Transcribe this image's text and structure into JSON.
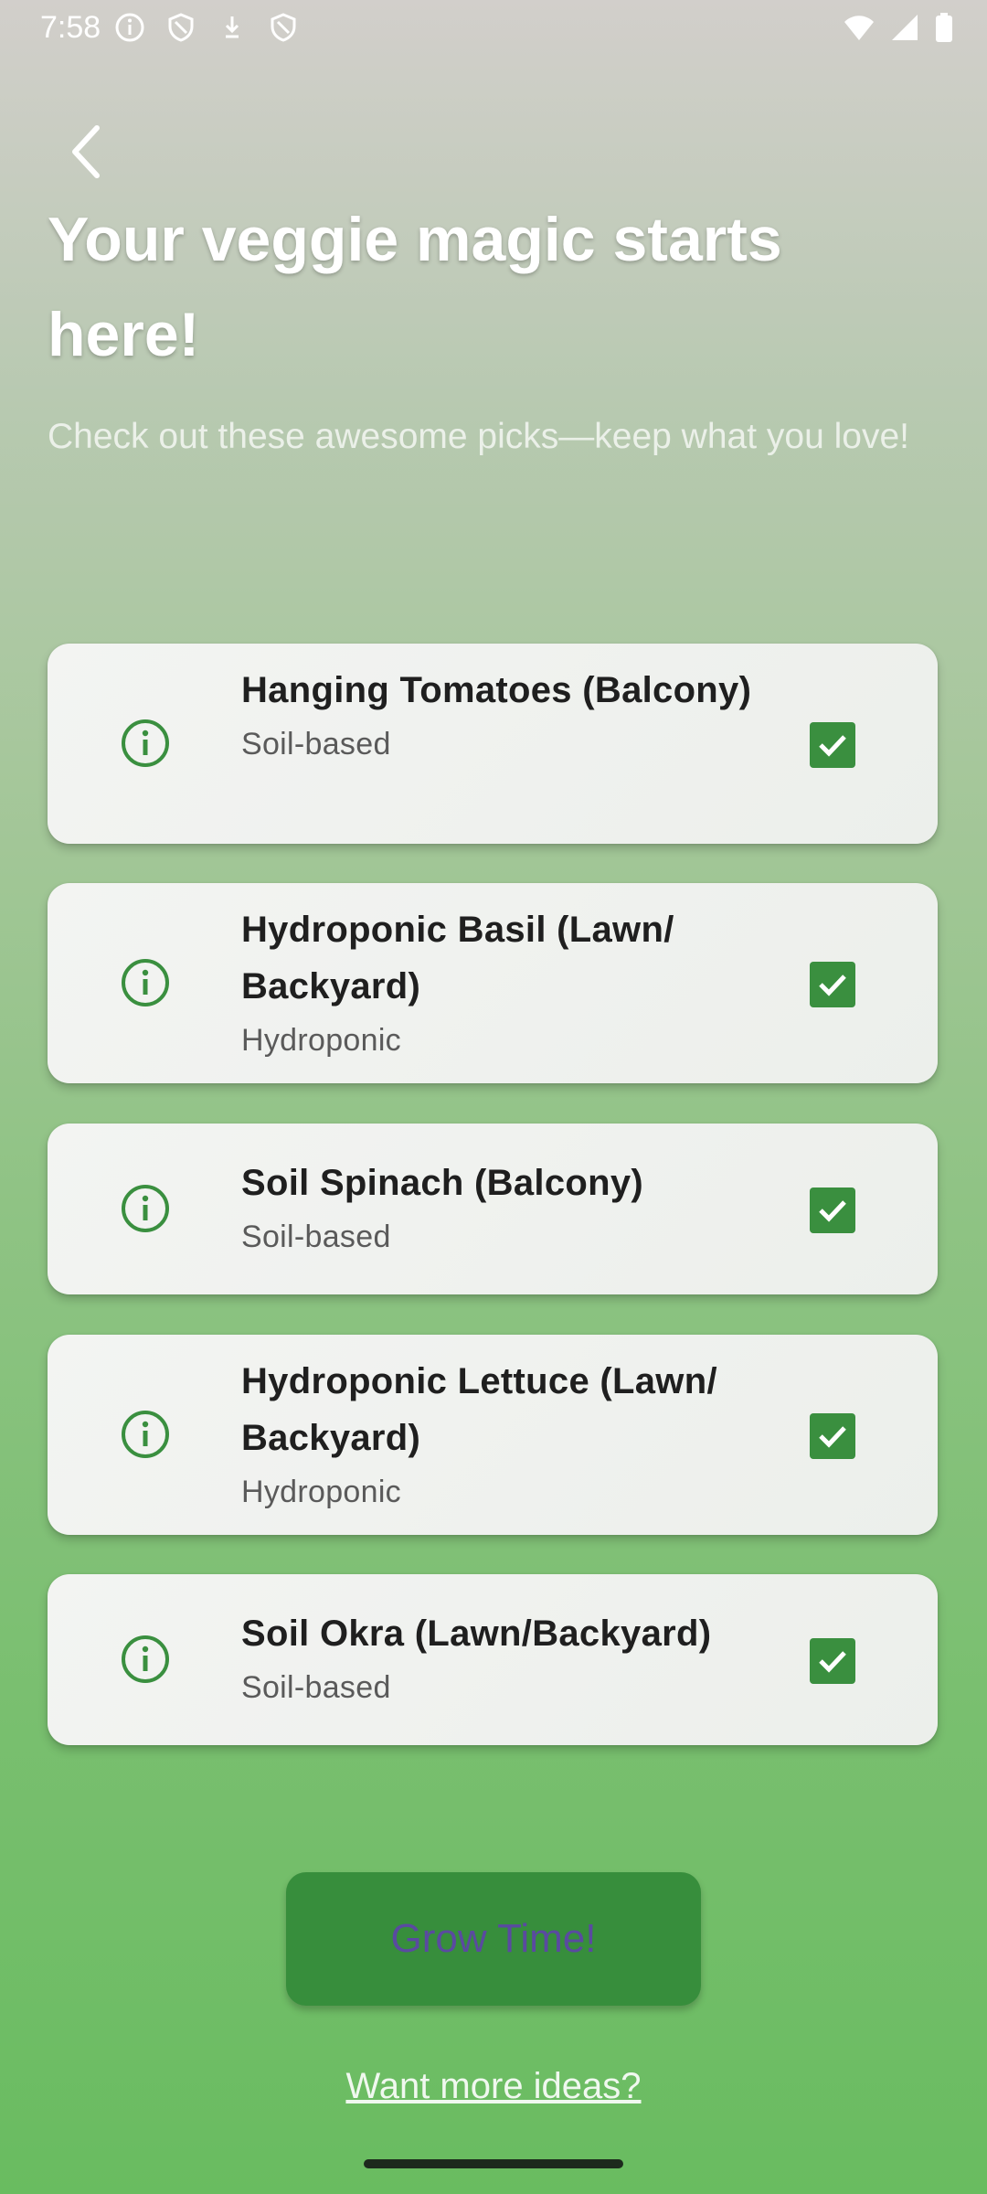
{
  "status_bar": {
    "time": "7:58",
    "left_icons": [
      "info-icon",
      "shield-icon",
      "download-icon",
      "shield-icon"
    ],
    "right_icons": [
      "wifi-icon",
      "signal-icon",
      "battery-icon"
    ]
  },
  "header": {
    "back_icon": "chevron-left-icon",
    "title": "Your veggie magic starts here!",
    "subtitle": "Check out these awesome picks—keep what you love!"
  },
  "plants": [
    {
      "name": "Hanging Tomatoes (Balcony)",
      "type": "Soil-based",
      "checked": true
    },
    {
      "name": "Hydroponic Basil (Lawn/ Backyard)",
      "type": "Hydroponic",
      "checked": true
    },
    {
      "name": "Soil Spinach (Balcony)",
      "type": "Soil-based",
      "checked": true
    },
    {
      "name": "Hydroponic Lettuce (Lawn/ Backyard)",
      "type": "Hydroponic",
      "checked": true
    },
    {
      "name": "Soil Okra (Lawn/Backyard)",
      "type": "Soil-based",
      "checked": true
    }
  ],
  "actions": {
    "grow_button": "Grow Time!",
    "more_link": "Want more ideas?"
  },
  "colors": {
    "accent_green": "#3a8f3f",
    "button_text": "#5a4aa0"
  }
}
